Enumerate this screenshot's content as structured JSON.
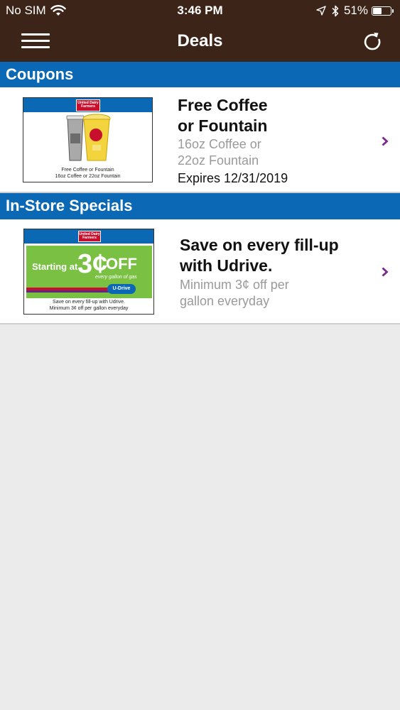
{
  "status_bar": {
    "carrier": "No SIM",
    "time": "3:46 PM",
    "battery": "51%",
    "battery_level": 0.51,
    "icons": [
      "wifi-icon",
      "location-arrow-icon",
      "bluetooth-icon",
      "battery-icon"
    ]
  },
  "nav": {
    "title": "Deals",
    "left_icon": "hamburger-menu-icon",
    "right_icon": "refresh-icon"
  },
  "colors": {
    "nav_bg": "#3d2418",
    "section_bg": "#0b68b5",
    "chevron": "#7b2a8c",
    "page_bg": "#ebebeb"
  },
  "sections": [
    {
      "title": "Coupons",
      "deals": [
        {
          "title": "Free Coffee\nor Fountain",
          "subtitle": "16oz Coffee or\n22oz Fountain",
          "expires": "Expires 12/31/2019",
          "image": {
            "logo_text": "United Dairy Farmers",
            "caption": "Free Coffee or Fountain\n16oz Coffee or 22oz Fountain"
          }
        }
      ]
    },
    {
      "title": "In-Store Specials",
      "deals": [
        {
          "title": "Save on every fill-up\nwith Udrive.",
          "subtitle": " Minimum 3¢ off per\ngallon everyday",
          "image": {
            "logo_text": "United Dairy Farmers",
            "headline_start": "Starting at",
            "headline_amount": "3¢",
            "headline_off": "OFF",
            "headline_sub": "every gallon of gas",
            "badge": "U-Drive",
            "caption": "Save on every fill-up with Udrive.\nMinimum 3¢ off per gallon everyday"
          }
        }
      ]
    }
  ]
}
